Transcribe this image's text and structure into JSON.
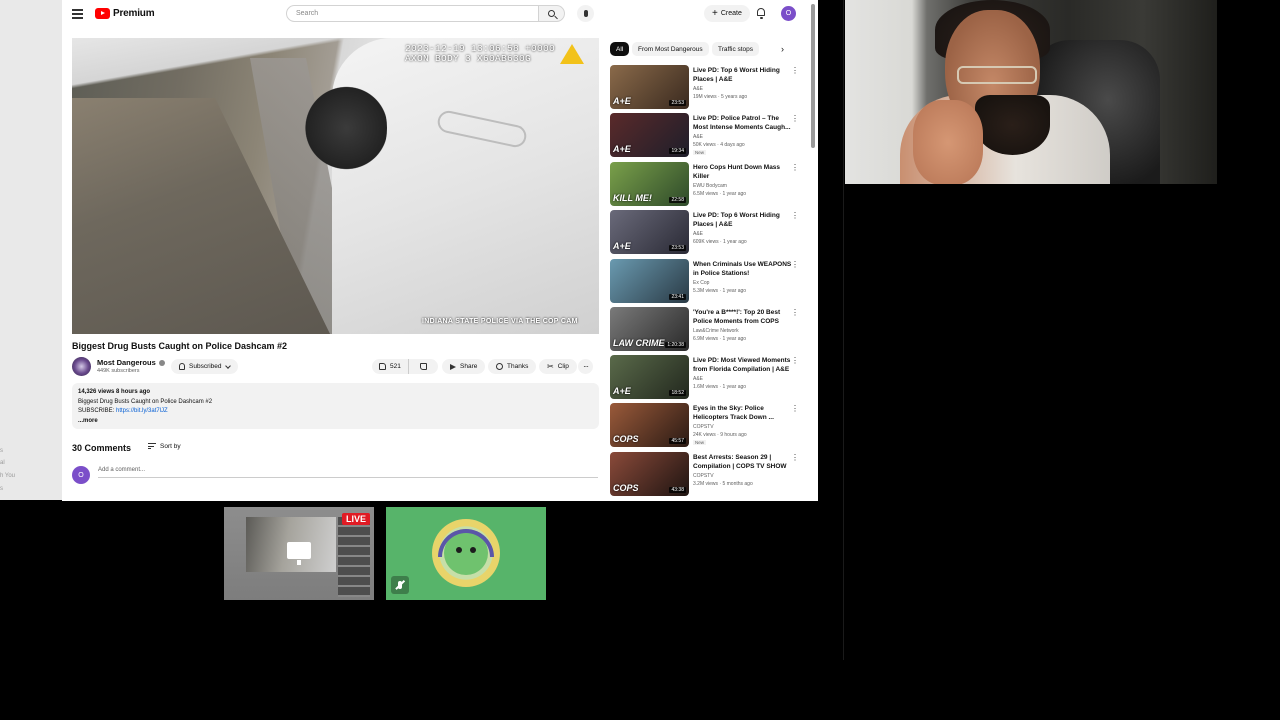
{
  "youtube": {
    "logo_text": "Premium",
    "search_placeholder": "Search",
    "create_label": "Create",
    "avatar_letter": "O",
    "player": {
      "stamp_line1": "2023-12-19 13:06:58 +0000",
      "stamp_line2": "AXON BODY 3 X60AB630G",
      "caption": "INDIANA STATE POLICE VIA THE COP CAM"
    },
    "video": {
      "title": "Biggest Drug Busts Caught on Police Dashcam #2",
      "channel": "Most Dangerous",
      "subscribers": "449K subscribers",
      "subscribed_label": "Subscribed",
      "likes": "521",
      "share_label": "Share",
      "thanks_label": "Thanks",
      "clip_label": "Clip"
    },
    "description": {
      "meta": "14,326 views  8 hours ago",
      "line1": "Biggest Drug Busts Caught on Police Dashcam #2",
      "subscribe_prefix": "SUBSCRIBE: ",
      "link": "https://bit.ly/3at7lJZ",
      "more": "...more"
    },
    "comments": {
      "count_label": "30 Comments",
      "sort_label": "Sort by",
      "avatar_letter": "O",
      "placeholder": "Add a comment..."
    },
    "chips": [
      "All",
      "From Most Dangerous",
      "Traffic stops"
    ],
    "recommendations": [
      {
        "title": "Live PD: Top 6 Worst Hiding Places | A&E",
        "channel": "A&E",
        "stats": "19M views · 5 years ago",
        "duration": "23:53",
        "badge": "",
        "thumb_text": "A+E",
        "color1": "#8a6a4a",
        "color2": "#3a2a1f"
      },
      {
        "title": "Live PD: Police Patrol – The Most Intense Moments Caugh...",
        "channel": "A&E",
        "stats": "50K views · 4 days ago",
        "duration": "19:34",
        "badge": "New",
        "thumb_text": "A+E",
        "color1": "#5a2a2a",
        "color2": "#1e1e2a"
      },
      {
        "title": "Hero Cops Hunt Down Mass Killer",
        "channel": "EWU Bodycam",
        "stats": "6.5M views · 1 year ago",
        "duration": "22:58",
        "badge": "",
        "thumb_text": "KILL ME!",
        "color1": "#7aa04a",
        "color2": "#2e4a2a"
      },
      {
        "title": "Live PD: Top 6 Worst Hiding Places | A&E",
        "channel": "A&E",
        "stats": "609K views · 1 year ago",
        "duration": "23:53",
        "badge": "",
        "thumb_text": "A+E",
        "color1": "#6a6a7a",
        "color2": "#2a2a35"
      },
      {
        "title": "When Criminals Use WEAPONS in Police Stations!",
        "channel": "Ex Cop",
        "stats": "5.3M views · 1 year ago",
        "duration": "23:41",
        "badge": "",
        "thumb_text": "",
        "color1": "#6a9ab0",
        "color2": "#2a3a45"
      },
      {
        "title": "'You're a B****!': Top 20 Best Police Moments from COPS",
        "channel": "Law&Crime Network",
        "stats": "6.9M views · 1 year ago",
        "duration": "1:20:38",
        "badge": "",
        "thumb_text": "LAW CRIME",
        "color1": "#7a7a7a",
        "color2": "#2a2a2a"
      },
      {
        "title": "Live PD: Most Viewed Moments from Florida Compilation | A&E",
        "channel": "A&E",
        "stats": "1.6M views · 1 year ago",
        "duration": "18:52",
        "badge": "",
        "thumb_text": "A+E",
        "color1": "#5a6a4a",
        "color2": "#22281e"
      },
      {
        "title": "Eyes in the Sky: Police Helicopters Track Down ...",
        "channel": "COPSTV",
        "stats": "24K views · 9 hours ago",
        "duration": "45:57",
        "badge": "New",
        "thumb_text": "COPS",
        "color1": "#9a5a3a",
        "color2": "#2a1a14"
      },
      {
        "title": "Best Arrests: Season 29 | Compilation | COPS TV SHOW",
        "channel": "COPSTV",
        "stats": "3.2M views · 5 months ago",
        "duration": "43:38",
        "badge": "",
        "thumb_text": "COPS",
        "color1": "#8a4a3a",
        "color2": "#1e1411"
      }
    ]
  },
  "left_strip": {
    "ghost_lines": [
      "s",
      "al",
      "h You",
      "s"
    ]
  },
  "call": {
    "live_label": "LIVE"
  }
}
